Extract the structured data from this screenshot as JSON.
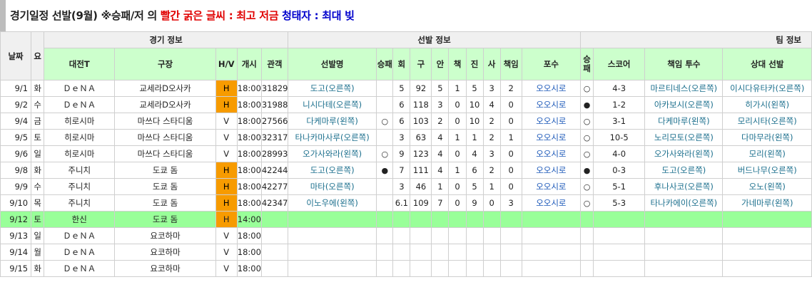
{
  "title": {
    "main": "경기일정 선발(9월) ※승패/저 의",
    "red_part": "빨간 굵은 글씨 : 최고 저금",
    "blue_part": "청태자 : 최대 빚"
  },
  "group_headers": {
    "game_info": "경기 정보",
    "starter_info": "선발 정보",
    "team_info": "팀 정보"
  },
  "columns": {
    "date": "날짜",
    "day": "요",
    "opponent": "대전T",
    "stadium": "구장",
    "hv": "H/V",
    "start": "개시",
    "attendance": "관객",
    "starter": "선발명",
    "wl": "승패",
    "inn": "회",
    "pitches": "구",
    "hits": "안",
    "runs": "책",
    "k": "진",
    "bb": "사",
    "er": "책임",
    "catcher": "포수",
    "twl": "승패",
    "score": "스코어",
    "resp": "책임 투수",
    "opp_starter": "상대 선발"
  },
  "rows": [
    {
      "date": "9/1",
      "day": "화",
      "opp": "ＤｅＮＡ",
      "stadium": "교세라D오사카",
      "hv": "H",
      "start": "18:00",
      "att": "31829",
      "starter": "도고(오른쪽)",
      "wl": "",
      "inn": "5",
      "pitches": "92",
      "hits": "5",
      "runs": "1",
      "k": "5",
      "bb": "3",
      "er": "2",
      "catcher": "오오시로",
      "twl": "○",
      "score": "4-3",
      "resp": "마르티네스(오른쪽)",
      "opp_starter": "이시다유타카(오른쪽)",
      "hl": false
    },
    {
      "date": "9/2",
      "day": "수",
      "opp": "ＤｅＮＡ",
      "stadium": "교세라D오사카",
      "hv": "H",
      "start": "18:00",
      "att": "31988",
      "starter": "니시다테(오른쪽)",
      "wl": "",
      "inn": "6",
      "pitches": "118",
      "hits": "3",
      "runs": "0",
      "k": "10",
      "bb": "4",
      "er": "0",
      "catcher": "오오시로",
      "twl": "●",
      "score": "1-2",
      "resp": "아카보시(오른쪽)",
      "opp_starter": "히가시(왼쪽)",
      "hl": false
    },
    {
      "date": "9/4",
      "day": "금",
      "opp": "히로시마",
      "stadium": "마쓰다 스타디움",
      "hv": "V",
      "start": "18:00",
      "att": "27566",
      "starter": "다케마루(왼쪽)",
      "wl": "○",
      "inn": "6",
      "pitches": "103",
      "hits": "2",
      "runs": "0",
      "k": "10",
      "bb": "2",
      "er": "0",
      "catcher": "오오시로",
      "twl": "○",
      "score": "3-1",
      "resp": "다케마루(왼쪽)",
      "opp_starter": "모리시타(오른쪽)",
      "hl": false
    },
    {
      "date": "9/5",
      "day": "토",
      "opp": "히로시마",
      "stadium": "마쓰다 스타디움",
      "hv": "V",
      "start": "18:00",
      "att": "32317",
      "starter": "타나카마사루(오른쪽)",
      "wl": "",
      "inn": "3",
      "pitches": "63",
      "hits": "4",
      "runs": "1",
      "k": "1",
      "bb": "2",
      "er": "1",
      "catcher": "오오시로",
      "twl": "○",
      "score": "10-5",
      "resp": "노리모토(오른쪽)",
      "opp_starter": "다마무라(왼쪽)",
      "hl": false
    },
    {
      "date": "9/6",
      "day": "일",
      "opp": "히로시마",
      "stadium": "마쓰다 스타디움",
      "hv": "V",
      "start": "18:00",
      "att": "28993",
      "starter": "오가사와라(왼쪽)",
      "wl": "○",
      "inn": "9",
      "pitches": "123",
      "hits": "4",
      "runs": "0",
      "k": "4",
      "bb": "3",
      "er": "0",
      "catcher": "오오시로",
      "twl": "○",
      "score": "4-0",
      "resp": "오가사와라(왼쪽)",
      "opp_starter": "모리(왼쪽)",
      "hl": false
    },
    {
      "date": "9/8",
      "day": "화",
      "opp": "주니치",
      "stadium": "도쿄 돔",
      "hv": "H",
      "start": "18:00",
      "att": "42244",
      "starter": "도고(오른쪽)",
      "wl": "●",
      "inn": "7",
      "pitches": "111",
      "hits": "4",
      "runs": "1",
      "k": "6",
      "bb": "2",
      "er": "0",
      "catcher": "오오시로",
      "twl": "●",
      "score": "0-3",
      "resp": "도고(오른쪽)",
      "opp_starter": "버드나무(오른쪽)",
      "hl": false
    },
    {
      "date": "9/9",
      "day": "수",
      "opp": "주니치",
      "stadium": "도쿄 돔",
      "hv": "H",
      "start": "18:00",
      "att": "42277",
      "starter": "마타(오른쪽)",
      "wl": "",
      "inn": "3",
      "pitches": "46",
      "hits": "1",
      "runs": "0",
      "k": "5",
      "bb": "1",
      "er": "0",
      "catcher": "오오시로",
      "twl": "○",
      "score": "5-1",
      "resp": "후나사코(오른쪽)",
      "opp_starter": "오노(왼쪽)",
      "hl": false
    },
    {
      "date": "9/10",
      "day": "목",
      "opp": "주니치",
      "stadium": "도쿄 돔",
      "hv": "H",
      "start": "18:00",
      "att": "42347",
      "starter": "이노우에(왼쪽)",
      "wl": "",
      "inn": "6.1",
      "pitches": "109",
      "hits": "7",
      "runs": "0",
      "k": "9",
      "bb": "0",
      "er": "3",
      "catcher": "오오시로",
      "twl": "○",
      "score": "5-3",
      "resp": "타나카에이(오른쪽)",
      "opp_starter": "가네마루(왼쪽)",
      "hl": false
    },
    {
      "date": "9/12",
      "day": "토",
      "opp": "한신",
      "stadium": "도쿄 돔",
      "hv": "H",
      "start": "14:00",
      "att": "",
      "starter": "",
      "wl": "",
      "inn": "",
      "pitches": "",
      "hits": "",
      "runs": "",
      "k": "",
      "bb": "",
      "er": "",
      "catcher": "",
      "twl": "",
      "score": "",
      "resp": "",
      "opp_starter": "",
      "hl": true
    },
    {
      "date": "9/13",
      "day": "일",
      "opp": "ＤｅＮＡ",
      "stadium": "요코하마",
      "hv": "V",
      "start": "18:00",
      "att": "",
      "starter": "",
      "wl": "",
      "inn": "",
      "pitches": "",
      "hits": "",
      "runs": "",
      "k": "",
      "bb": "",
      "er": "",
      "catcher": "",
      "twl": "",
      "score": "",
      "resp": "",
      "opp_starter": "",
      "hl": false
    },
    {
      "date": "9/14",
      "day": "월",
      "opp": "ＤｅＮＡ",
      "stadium": "요코하마",
      "hv": "V",
      "start": "18:00",
      "att": "",
      "starter": "",
      "wl": "",
      "inn": "",
      "pitches": "",
      "hits": "",
      "runs": "",
      "k": "",
      "bb": "",
      "er": "",
      "catcher": "",
      "twl": "",
      "score": "",
      "resp": "",
      "opp_starter": "",
      "hl": false
    },
    {
      "date": "9/15",
      "day": "화",
      "opp": "ＤｅＮＡ",
      "stadium": "요코하마",
      "hv": "V",
      "start": "18:00",
      "att": "",
      "starter": "",
      "wl": "",
      "inn": "",
      "pitches": "",
      "hits": "",
      "runs": "",
      "k": "",
      "bb": "",
      "er": "",
      "catcher": "",
      "twl": "",
      "score": "",
      "resp": "",
      "opp_starter": "",
      "hl": false
    }
  ],
  "colors": {
    "header_green": "#ccffcc",
    "highlight_row": "#99ff99",
    "home_badge": "#f79b00",
    "link_blue": "#1a57b8"
  }
}
